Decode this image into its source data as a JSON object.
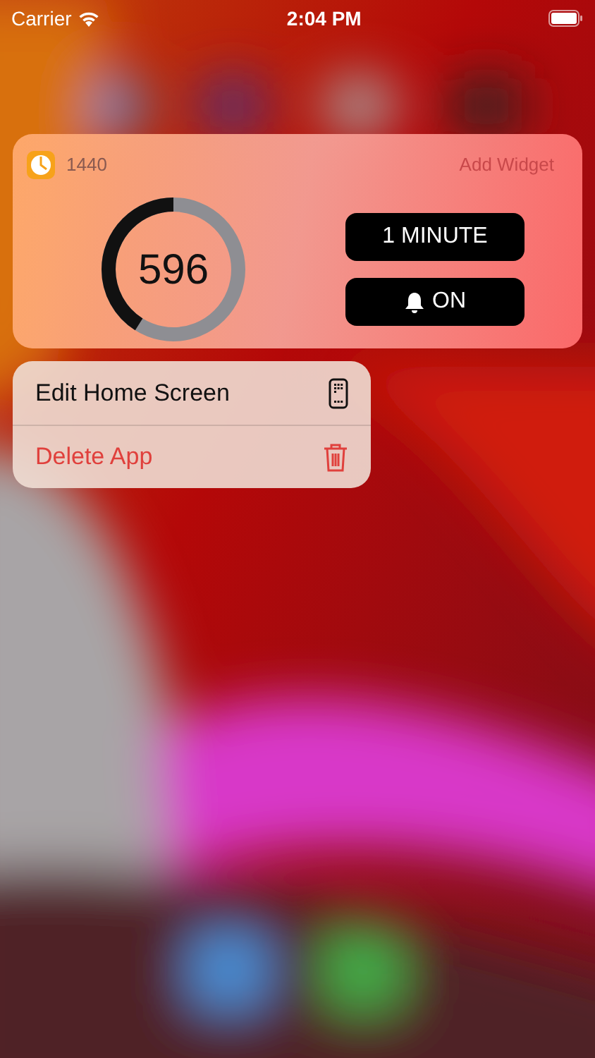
{
  "status_bar": {
    "carrier": "Carrier",
    "time": "2:04 PM"
  },
  "widget": {
    "app_name": "1440",
    "action": "Add Widget",
    "counter": "596",
    "ring": {
      "level": 0.41
    },
    "buttons": [
      {
        "label": "1 MINUTE",
        "kind": "text"
      },
      {
        "label": "ON",
        "kind": "bell"
      }
    ]
  },
  "menu": [
    {
      "label": "Edit Home Screen",
      "kind": "normal"
    },
    {
      "label": "Delete App",
      "kind": "destructive"
    }
  ]
}
